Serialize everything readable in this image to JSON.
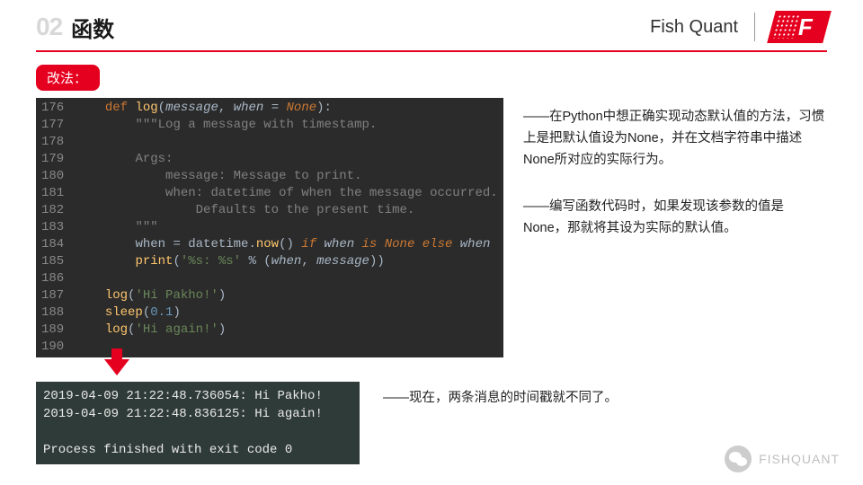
{
  "header": {
    "chapter_number": "02",
    "chapter_title": "函数",
    "brand_name": "Fish Quant",
    "logo_letter": "F"
  },
  "tag_label": "改法：",
  "code": {
    "line_start": 176,
    "lines": [
      {
        "n": 176,
        "tokens": [
          {
            "t": "def ",
            "c": "kw"
          },
          {
            "t": "log",
            "c": "fn"
          },
          {
            "t": "(",
            "c": "prm"
          },
          {
            "t": "message",
            "c": "prm-it"
          },
          {
            "t": ", ",
            "c": "prm"
          },
          {
            "t": "when",
            "c": "prm-it"
          },
          {
            "t": " = ",
            "c": "prm"
          },
          {
            "t": "None",
            "c": "none"
          },
          {
            "t": "):",
            "c": "prm"
          }
        ],
        "indent": 1
      },
      {
        "n": 177,
        "tokens": [
          {
            "t": "\"\"\"Log a message with timestamp.",
            "c": "cmt"
          }
        ],
        "indent": 2
      },
      {
        "n": 178,
        "tokens": [],
        "indent": 0
      },
      {
        "n": 179,
        "tokens": [
          {
            "t": "Args:",
            "c": "cmt"
          }
        ],
        "indent": 2
      },
      {
        "n": 180,
        "tokens": [
          {
            "t": "    message: Message to print.",
            "c": "cmt"
          }
        ],
        "indent": 2
      },
      {
        "n": 181,
        "tokens": [
          {
            "t": "    when: datetime of when the message occurred.",
            "c": "cmt"
          }
        ],
        "indent": 2
      },
      {
        "n": 182,
        "tokens": [
          {
            "t": "        Defaults to the present time.",
            "c": "cmt"
          }
        ],
        "indent": 2
      },
      {
        "n": 183,
        "tokens": [
          {
            "t": "\"\"\"",
            "c": "cmt"
          }
        ],
        "indent": 2
      },
      {
        "n": 184,
        "tokens": [
          {
            "t": "when = datetime.",
            "c": "prm"
          },
          {
            "t": "now",
            "c": "fn"
          },
          {
            "t": "() ",
            "c": "prm"
          },
          {
            "t": "if ",
            "c": "kw-it"
          },
          {
            "t": "when ",
            "c": "prm-it"
          },
          {
            "t": "is ",
            "c": "kw-it"
          },
          {
            "t": "None ",
            "c": "none"
          },
          {
            "t": "else ",
            "c": "kw-it"
          },
          {
            "t": "when",
            "c": "prm-it"
          }
        ],
        "indent": 2
      },
      {
        "n": 185,
        "tokens": [
          {
            "t": "print",
            "c": "fn"
          },
          {
            "t": "(",
            "c": "prm"
          },
          {
            "t": "'%s: %s' ",
            "c": "str"
          },
          {
            "t": "% (",
            "c": "prm"
          },
          {
            "t": "when",
            "c": "prm-it"
          },
          {
            "t": ", ",
            "c": "prm"
          },
          {
            "t": "message",
            "c": "prm-it"
          },
          {
            "t": "))",
            "c": "prm"
          }
        ],
        "indent": 2
      },
      {
        "n": 186,
        "tokens": [],
        "indent": 0
      },
      {
        "n": 187,
        "tokens": [
          {
            "t": "log",
            "c": "fn"
          },
          {
            "t": "(",
            "c": "prm"
          },
          {
            "t": "'Hi Pakho!'",
            "c": "str"
          },
          {
            "t": ")",
            "c": "prm"
          }
        ],
        "indent": 1
      },
      {
        "n": 188,
        "tokens": [
          {
            "t": "sleep",
            "c": "fn"
          },
          {
            "t": "(",
            "c": "prm"
          },
          {
            "t": "0.1",
            "c": "num"
          },
          {
            "t": ")",
            "c": "prm"
          }
        ],
        "indent": 1
      },
      {
        "n": 189,
        "tokens": [
          {
            "t": "log",
            "c": "fn"
          },
          {
            "t": "(",
            "c": "prm"
          },
          {
            "t": "'Hi again!'",
            "c": "str"
          },
          {
            "t": ")",
            "c": "prm"
          }
        ],
        "indent": 1
      },
      {
        "n": 190,
        "tokens": [],
        "indent": 0
      }
    ]
  },
  "explanations": {
    "p1": "——在Python中想正确实现动态默认值的方法，习惯上是把默认值设为None，并在文档字符串中描述None所对应的实际行为。",
    "p2": "——编写函数代码时，如果发现该参数的值是None，那就将其设为实际的默认值。",
    "output_note": "——现在，两条消息的时间戳就不同了。"
  },
  "terminal": {
    "lines": [
      "2019-04-09 21:22:48.736054: Hi Pakho!",
      "2019-04-09 21:22:48.836125: Hi again!",
      "",
      "Process finished with exit code 0"
    ]
  },
  "footer": {
    "account": "FISHQUANT"
  }
}
